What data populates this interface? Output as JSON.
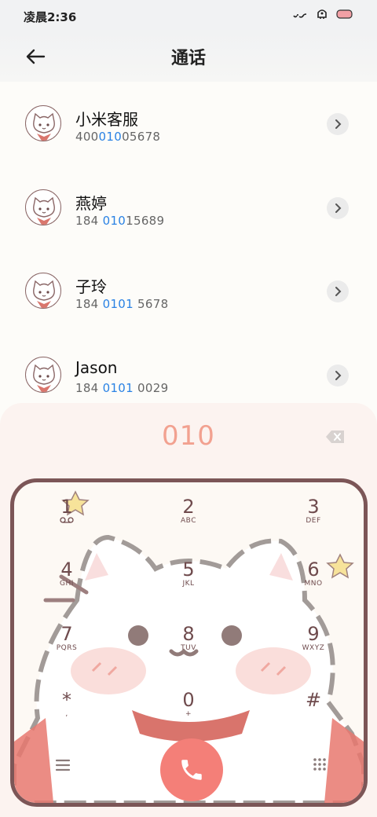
{
  "status_bar": {
    "time": "凌晨2:36"
  },
  "header": {
    "title": "通话",
    "back_icon": "back-arrow-icon"
  },
  "contacts": [
    {
      "name": "小米客服",
      "number_prefix": "400",
      "number_match": "010",
      "number_suffix": "05678"
    },
    {
      "name": "燕婷",
      "number_prefix": "184 ",
      "number_match": "010",
      "number_suffix": "15689"
    },
    {
      "name": "子玲",
      "number_prefix": "184 ",
      "number_match": "0101",
      "number_suffix": " 5678"
    },
    {
      "name": "Jason",
      "number_prefix": "184 ",
      "number_match": "0101",
      "number_suffix": " 0029"
    }
  ],
  "dialer": {
    "input": "010",
    "keys": [
      {
        "digit": "1",
        "letters": ""
      },
      {
        "digit": "2",
        "letters": "ABC"
      },
      {
        "digit": "3",
        "letters": "DEF"
      },
      {
        "digit": "4",
        "letters": "GHI"
      },
      {
        "digit": "5",
        "letters": "JKL"
      },
      {
        "digit": "6",
        "letters": "MNO"
      },
      {
        "digit": "7",
        "letters": "PQRS"
      },
      {
        "digit": "8",
        "letters": "TUV"
      },
      {
        "digit": "9",
        "letters": "WXYZ"
      },
      {
        "digit": "*",
        "letters": ","
      },
      {
        "digit": "0",
        "letters": "+"
      },
      {
        "digit": "#",
        "letters": ""
      }
    ]
  },
  "colors": {
    "accent_highlight": "#2a82e4",
    "dial_input": "#f2a190",
    "frame": "#7c5657",
    "call_button": "#f47f78"
  }
}
